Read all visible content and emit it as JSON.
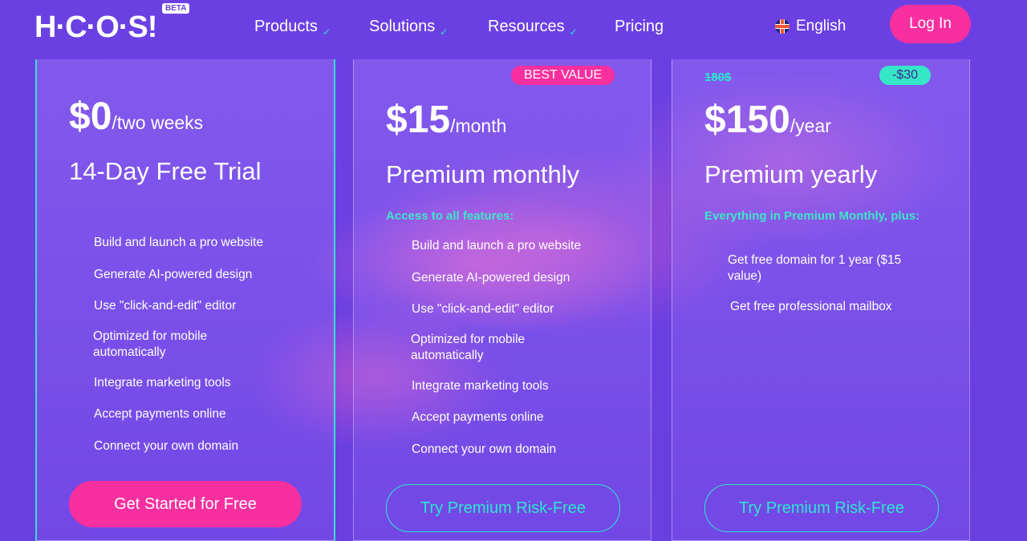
{
  "header": {
    "logo": "H·C·O·S!",
    "beta": "BETA",
    "nav": [
      "Products",
      "Solutions",
      "Resources",
      "Pricing"
    ],
    "language": "English",
    "login": "Log In"
  },
  "plans": [
    {
      "price": "$0",
      "period": "/two weeks",
      "name": "14-Day Free Trial",
      "features": [
        "Build and launch a pro website",
        "Generate AI-powered design",
        "Use \"click-and-edit\" editor",
        "Optimized for mobile automatically",
        "Integrate marketing tools",
        "Accept payments online",
        "Connect your own domain"
      ],
      "cta": "Get Started for Free"
    },
    {
      "badge": "BEST VALUE",
      "price": "$15",
      "period": "/month",
      "name": "Premium monthly",
      "features_head": "Access to all features:",
      "features": [
        "Build and launch a pro website",
        "Generate AI-powered design",
        "Use \"click-and-edit\" editor",
        "Optimized for mobile automatically",
        "Integrate marketing tools",
        "Accept payments online",
        "Connect your own domain"
      ],
      "cta": "Try Premium Risk-Free"
    },
    {
      "old_price": "180$",
      "badge": "-$30",
      "price": "$150",
      "period": "/year",
      "name": "Premium yearly",
      "features_head": "Everything in Premium Monthly, plus:",
      "features": [
        "Get free domain for 1 year ($15 value)",
        "Get free professional mailbox"
      ],
      "cta": "Try Premium Risk-Free"
    }
  ]
}
